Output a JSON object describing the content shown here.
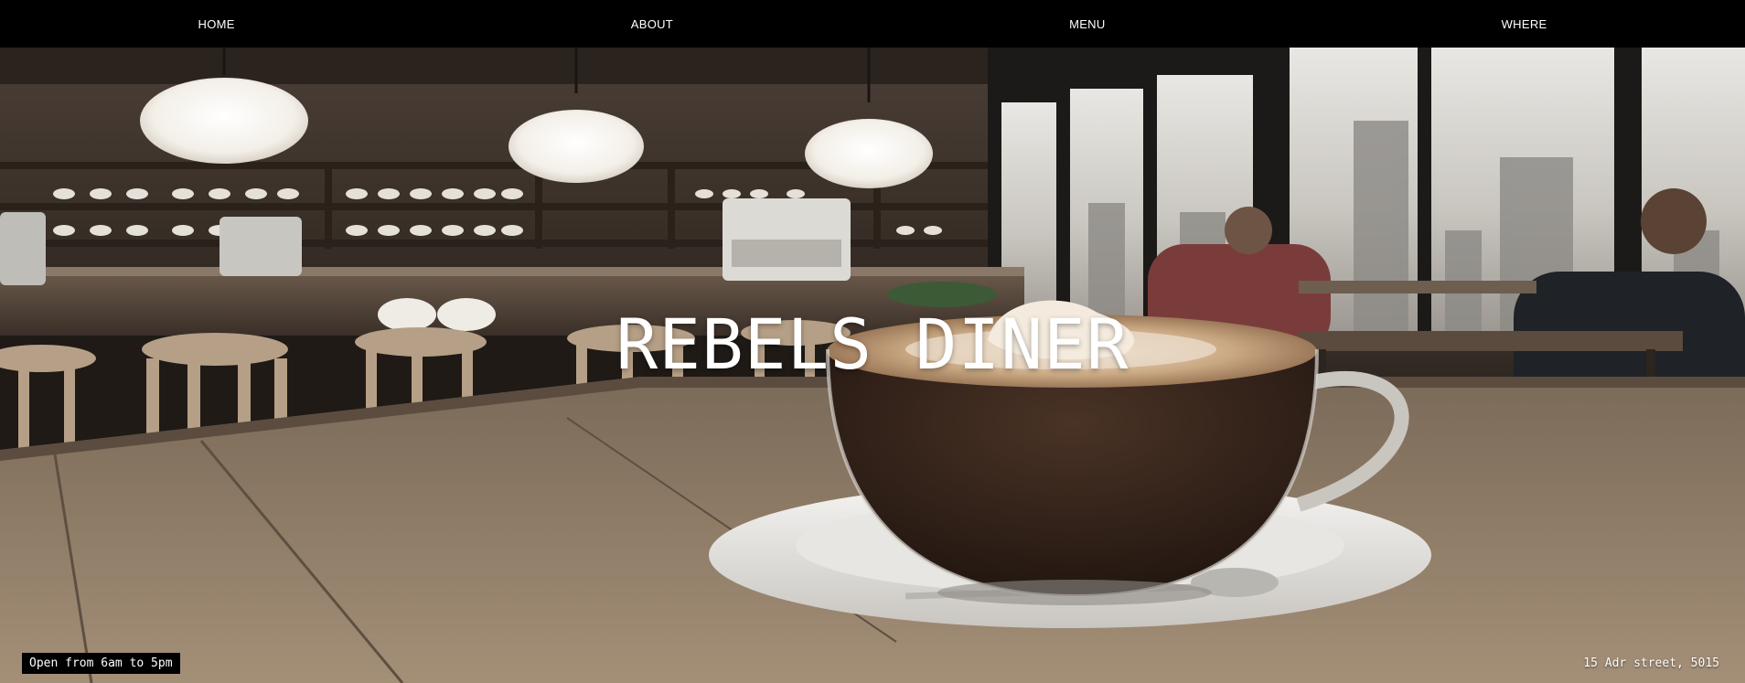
{
  "nav": {
    "items": [
      {
        "label": "HOME"
      },
      {
        "label": "ABOUT"
      },
      {
        "label": "MENU"
      },
      {
        "label": "WHERE"
      }
    ]
  },
  "hero": {
    "title": "REBELS DINER",
    "image_subject": "cafe-interior-with-cappuccino"
  },
  "footer": {
    "hours": "Open from 6am to 5pm",
    "address": "15 Adr street, 5015"
  },
  "colors": {
    "nav_bg": "#000000",
    "text": "#ffffff",
    "badge_bg": "#000000"
  }
}
